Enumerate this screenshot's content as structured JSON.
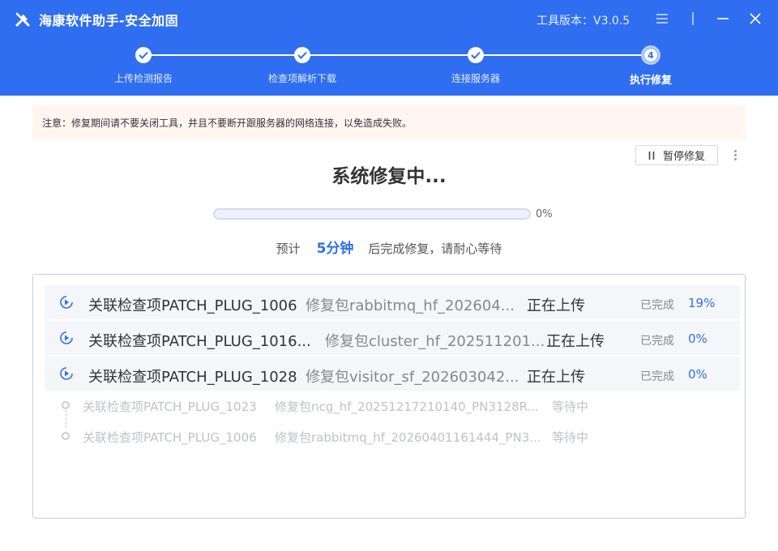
{
  "app": {
    "title": "海康软件助手-安全加固",
    "version_text": "工具版本：V3.0.5",
    "icons": [
      "tools-icon",
      "menu-icon",
      "minimize-icon",
      "close-icon"
    ]
  },
  "steps": [
    {
      "label": "上传检测报告",
      "status": "done"
    },
    {
      "label": "检查项解析下载",
      "status": "done"
    },
    {
      "label": "连接服务器",
      "status": "done"
    },
    {
      "label": "执行修复",
      "status": "current",
      "number": "4"
    }
  ],
  "notice": "注意：修复期间请不要关闭工具，并且不要断开跟服务器的网络连接，以免造成失败。",
  "pause_button": "暂停修复",
  "main_title": "系统修复中...",
  "progress": {
    "value": 0,
    "label": "0%"
  },
  "eta": {
    "prefix": "预计",
    "value": "5分钟",
    "suffix": "后完成修复，请耐心等待"
  },
  "active_tasks": [
    {
      "check": "关联检查项PATCH_PLUG_1006",
      "package": "修复包rabbitmq_hf_202604...",
      "status": "正在上传",
      "done_label": "已完成",
      "percent": "19%"
    },
    {
      "check": "关联检查项PATCH_PLUG_1016...",
      "package": "修复包cluster_hf_202511201...",
      "status": "正在上传",
      "done_label": "已完成",
      "percent": "0%"
    },
    {
      "check": "关联检查项PATCH_PLUG_1028",
      "package": "修复包visitor_sf_202603042...",
      "status": "正在上传",
      "done_label": "已完成",
      "percent": "0%"
    }
  ],
  "waiting_tasks": [
    {
      "check": "关联检查项PATCH_PLUG_1023",
      "package": "修复包ncg_hf_20251217210140_PN3128R...",
      "status": "等待中"
    },
    {
      "check": "关联检查项PATCH_PLUG_1006",
      "package": "修复包rabbitmq_hf_20260401161444_PN3...",
      "status": "等待中"
    }
  ],
  "colors": {
    "brand": "#2f6ef0",
    "notice_bg": "#fff6f1",
    "row_bg": "#f4f6fa"
  }
}
